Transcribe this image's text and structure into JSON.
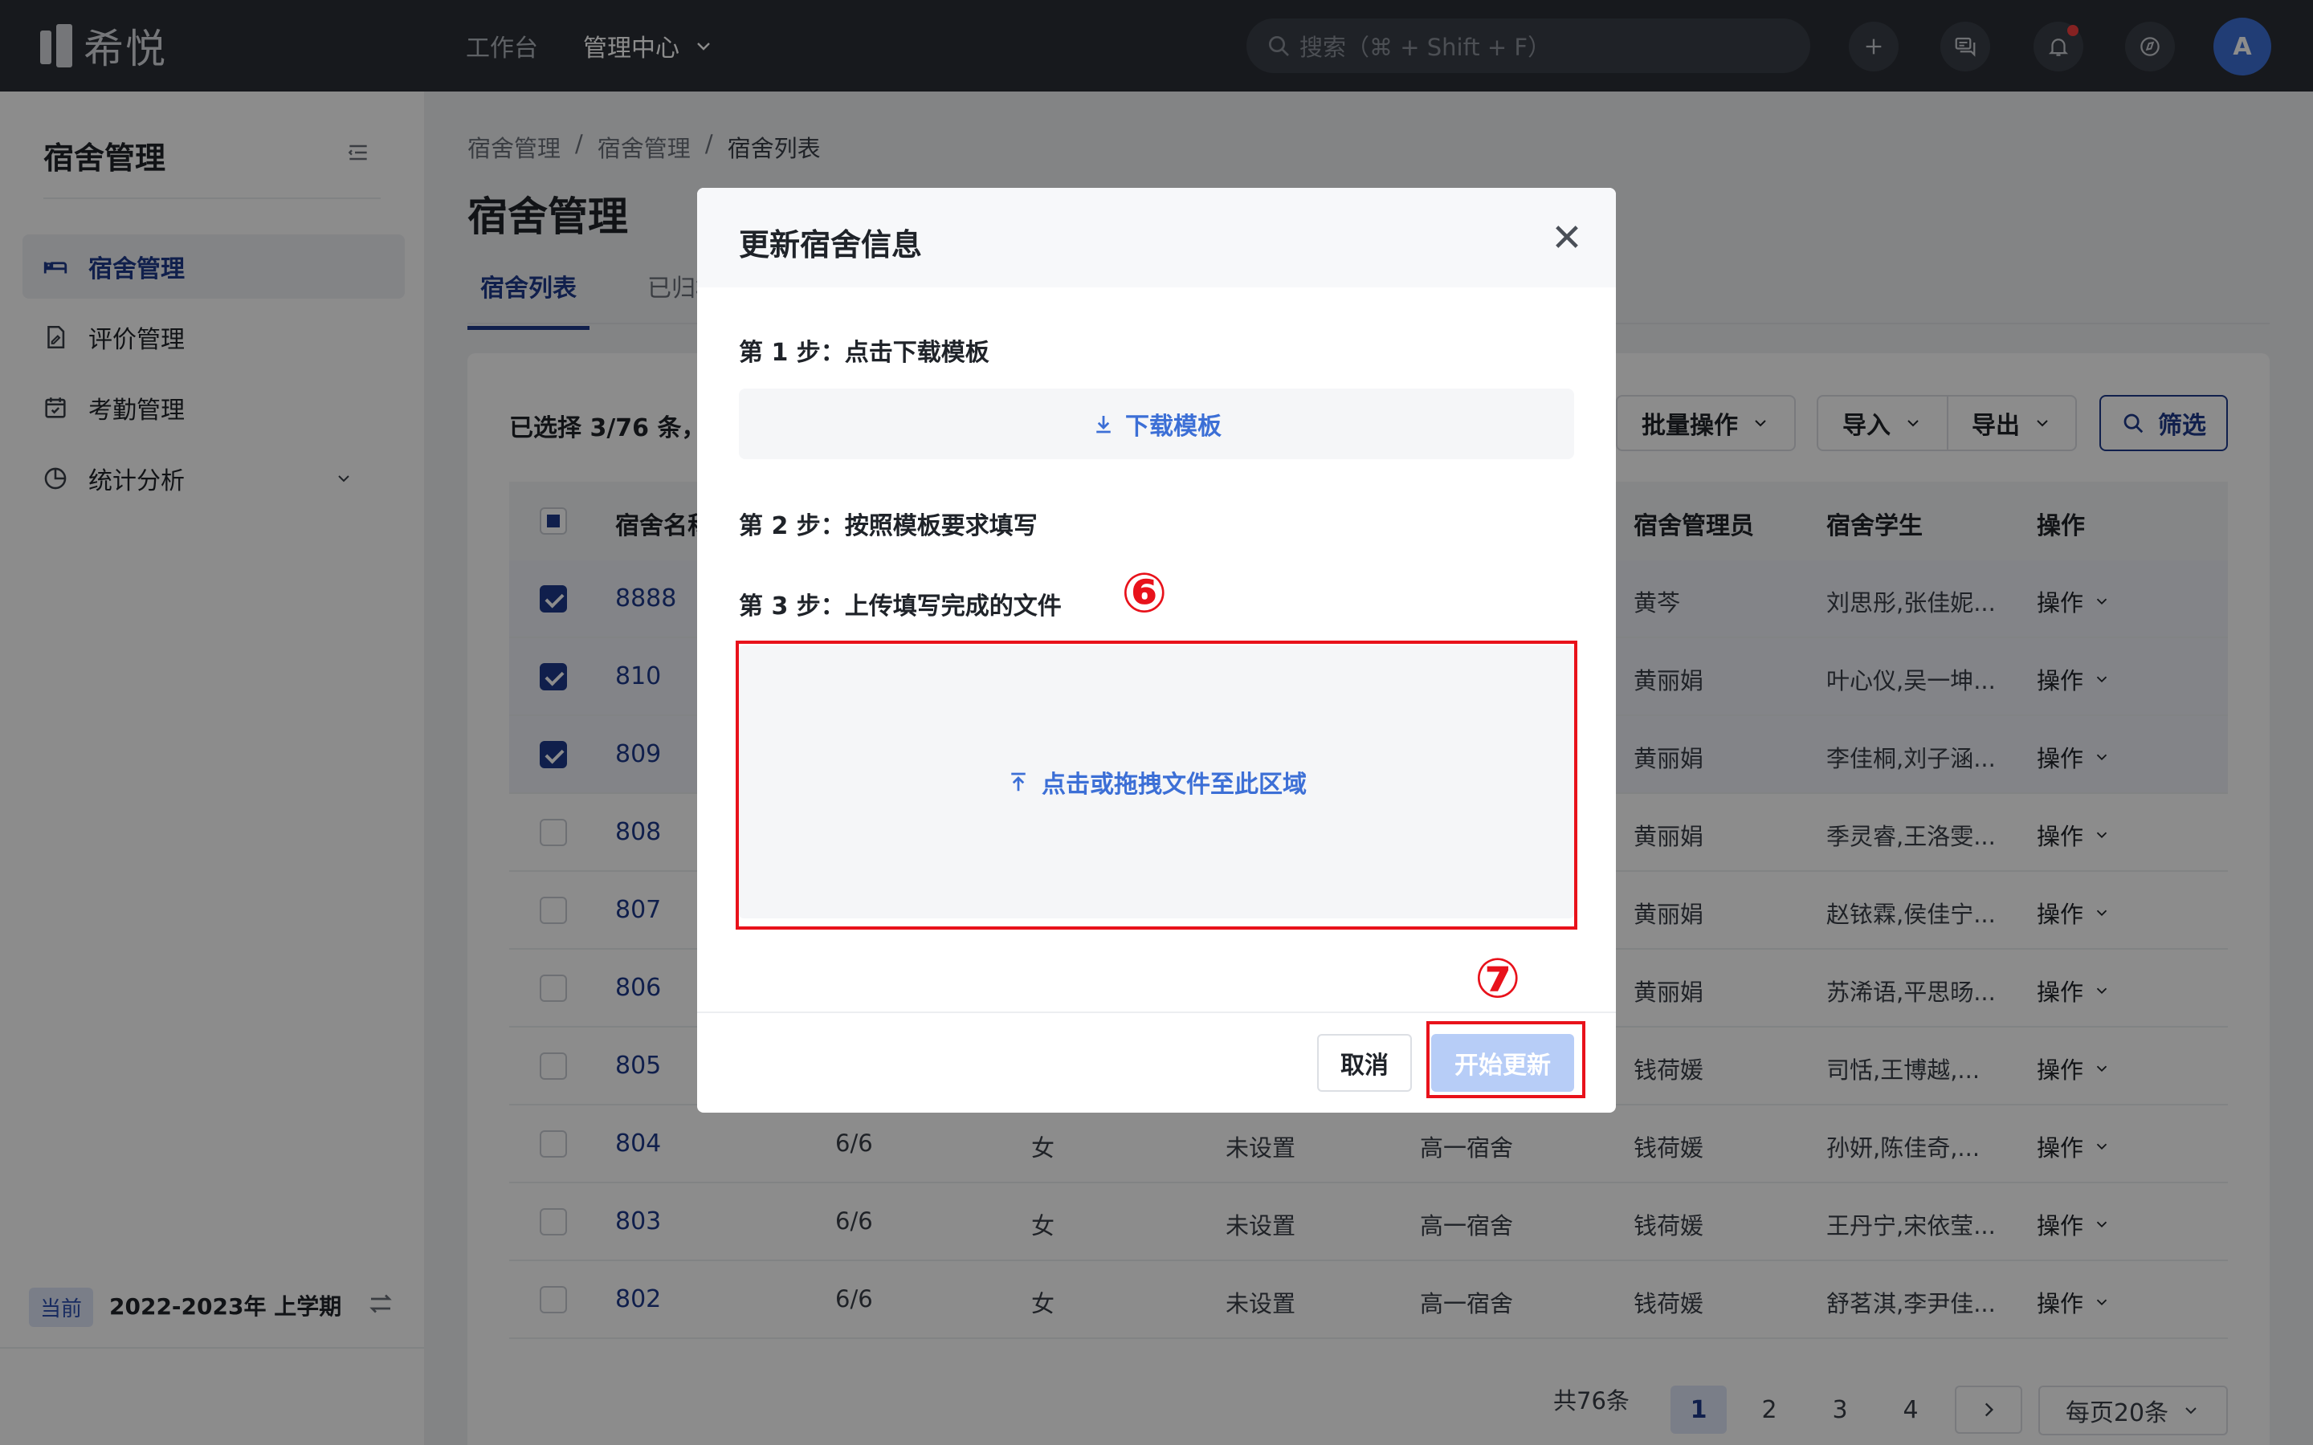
{
  "app": {
    "logo_text": "希悦"
  },
  "topnav": {
    "items": [
      "工作台"
    ],
    "active": "管理中心"
  },
  "search": {
    "placeholder": "搜索（⌘ + Shift + F）"
  },
  "user": {
    "avatar_letter": "A"
  },
  "sidebar": {
    "title": "宿舍管理",
    "items": [
      {
        "label": "宿舍管理",
        "icon": "bed-icon",
        "active": true
      },
      {
        "label": "评价管理",
        "icon": "document-edit-icon"
      },
      {
        "label": "考勤管理",
        "icon": "calendar-check-icon"
      },
      {
        "label": "统计分析",
        "icon": "pie-chart-icon",
        "expandable": true
      }
    ],
    "term_badge": "当前",
    "term_text": "2022-2023年 上学期"
  },
  "breadcrumb": [
    "宿舍管理",
    "宿舍管理",
    "宿舍列表"
  ],
  "page_title": "宿舍管理",
  "tabs": [
    "宿舍列表",
    "已归档"
  ],
  "toolbar": {
    "selected_text": "已选择 3/76 条，",
    "batch_label": "批量操作",
    "import_label": "导入",
    "export_label": "导出",
    "filter_label": "筛选"
  },
  "table": {
    "headers": {
      "name": "宿舍名称",
      "manager": "宿舍管理员",
      "students": "宿舍学生",
      "ops": "操作"
    },
    "op_label": "操作",
    "rows": [
      {
        "name": "8888",
        "count": "",
        "gender": "",
        "status": "",
        "building": "",
        "manager": "黄芩",
        "students": "刘思彤,张佳妮...",
        "selected": true
      },
      {
        "name": "810",
        "count": "",
        "gender": "",
        "status": "",
        "building": "",
        "manager": "黄丽娟",
        "students": "叶心仪,吴一坤...",
        "selected": true
      },
      {
        "name": "809",
        "count": "",
        "gender": "",
        "status": "",
        "building": "",
        "manager": "黄丽娟",
        "students": "李佳桐,刘子涵...",
        "selected": true
      },
      {
        "name": "808",
        "count": "",
        "gender": "",
        "status": "",
        "building": "",
        "manager": "黄丽娟",
        "students": "季灵睿,王洛雯...",
        "selected": false
      },
      {
        "name": "807",
        "count": "",
        "gender": "",
        "status": "",
        "building": "",
        "manager": "黄丽娟",
        "students": "赵铱霖,侯佳宁...",
        "selected": false
      },
      {
        "name": "806",
        "count": "",
        "gender": "",
        "status": "",
        "building": "",
        "manager": "黄丽娟",
        "students": "苏浠语,平思旸...",
        "selected": false
      },
      {
        "name": "805",
        "count": "",
        "gender": "",
        "status": "",
        "building": "",
        "manager": "钱荷媛",
        "students": "司恬,王博越,...",
        "selected": false
      },
      {
        "name": "804",
        "count": "6/6",
        "gender": "女",
        "status": "未设置",
        "building": "高一宿舍",
        "manager": "钱荷媛",
        "students": "孙妍,陈佳奇,...",
        "selected": false
      },
      {
        "name": "803",
        "count": "6/6",
        "gender": "女",
        "status": "未设置",
        "building": "高一宿舍",
        "manager": "钱荷媛",
        "students": "王丹宁,宋依莹...",
        "selected": false
      },
      {
        "name": "802",
        "count": "6/6",
        "gender": "女",
        "status": "未设置",
        "building": "高一宿舍",
        "manager": "钱荷媛",
        "students": "舒茗淇,李尹佳...",
        "selected": false
      }
    ]
  },
  "pagination": {
    "total": "共76条",
    "pages": [
      "1",
      "2",
      "3",
      "4"
    ],
    "current": "1",
    "page_size": "每页20条"
  },
  "modal": {
    "title": "更新宿舍信息",
    "step1": "第 1 步：点击下载模板",
    "download_label": "下载模板",
    "step2": "第 2 步：按照模板要求填写",
    "step3": "第 3 步：上传填写完成的文件",
    "upload_label": "点击或拖拽文件至此区域",
    "cancel_label": "取消",
    "start_label": "开始更新"
  },
  "annotations": {
    "marker_6": "⑥",
    "marker_7": "⑦",
    "color": "#e8121b"
  },
  "colors": {
    "accent": "#1e3a8a",
    "link": "#3c6fd6",
    "topbar": "#2b2f36"
  }
}
